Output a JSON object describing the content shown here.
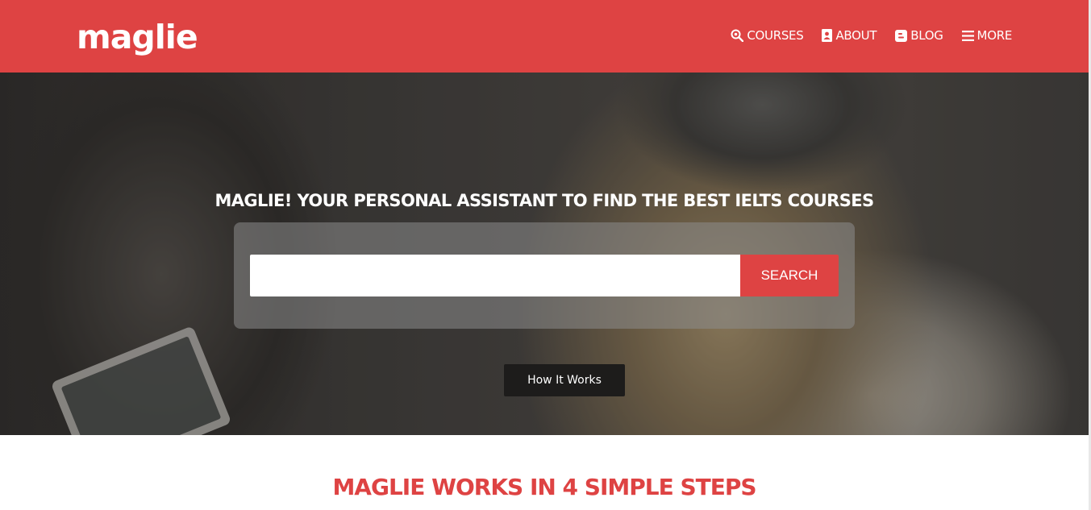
{
  "header": {
    "logo": "maglie",
    "brand_color": "#de4343",
    "nav": [
      {
        "label": "COURSES",
        "icon": "search-icon"
      },
      {
        "label": "ABOUT",
        "icon": "contact-card-icon"
      },
      {
        "label": "BLOG",
        "icon": "blogger-icon"
      },
      {
        "label": "MORE",
        "icon": "menu-icon"
      }
    ]
  },
  "hero": {
    "title": "MAGLIE! YOUR PERSONAL ASSISTANT TO FIND THE BEST IELTS COURSES",
    "search": {
      "value": "",
      "placeholder": "",
      "button_label": "SEARCH"
    },
    "how_it_works_label": "How It Works"
  },
  "steps": {
    "title": "MAGLIE WORKS IN 4 SIMPLE STEPS"
  }
}
